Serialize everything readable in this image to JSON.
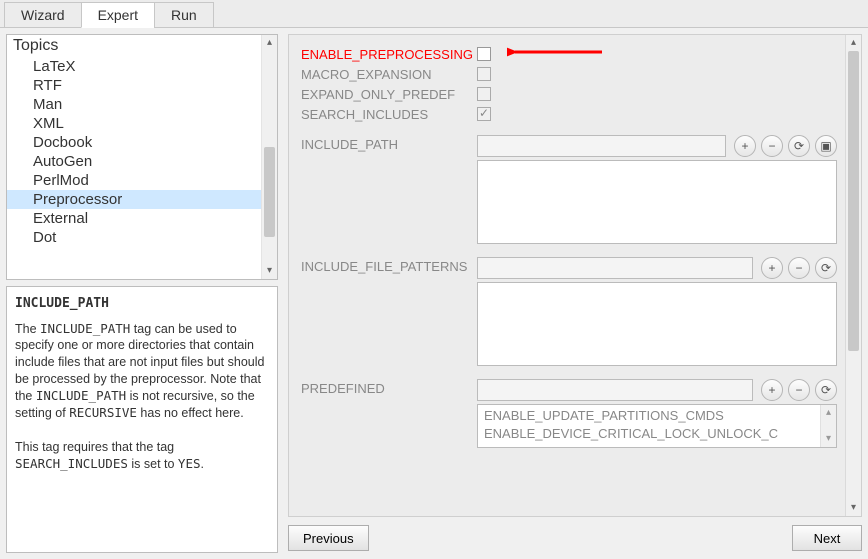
{
  "tabs": {
    "wizard": "Wizard",
    "expert": "Expert",
    "run": "Run",
    "active": "expert"
  },
  "tree": {
    "title": "Topics",
    "items": [
      {
        "label": "LaTeX"
      },
      {
        "label": "RTF"
      },
      {
        "label": "Man"
      },
      {
        "label": "XML"
      },
      {
        "label": "Docbook"
      },
      {
        "label": "AutoGen"
      },
      {
        "label": "PerlMod"
      },
      {
        "label": "Preprocessor",
        "selected": true
      },
      {
        "label": "External"
      },
      {
        "label": "Dot"
      }
    ]
  },
  "help": {
    "title": "INCLUDE_PATH",
    "para1_a": "The ",
    "para1_m1": "INCLUDE_PATH",
    "para1_b": " tag can be used to specify one or more directories that contain include files that are not input files but should be processed by the preprocessor. Note that the ",
    "para1_m2": "INCLUDE_PATH",
    "para1_c": " is not recursive, so the setting of ",
    "para1_m3": "RECURSIVE",
    "para1_d": " has no effect here.",
    "para2_a": "This tag requires that the tag ",
    "para2_m1": "SEARCH_INCLUDES",
    "para2_b": " is set to ",
    "para2_m2": "YES",
    "para2_c": "."
  },
  "form": {
    "enable_preprocessing": "ENABLE_PREPROCESSING",
    "macro_expansion": "MACRO_EXPANSION",
    "expand_only_predef": "EXPAND_ONLY_PREDEF",
    "search_includes": "SEARCH_INCLUDES",
    "include_path": "INCLUDE_PATH",
    "include_file_patterns": "INCLUDE_FILE_PATTERNS",
    "predefined": "PREDEFINED",
    "predefined_items": [
      "ENABLE_UPDATE_PARTITIONS_CMDS",
      "ENABLE_DEVICE_CRITICAL_LOCK_UNLOCK_C"
    ]
  },
  "icons": {
    "plus": "+",
    "minus": "−",
    "refresh": "⟳",
    "folder": "▣"
  },
  "nav": {
    "previous": "Previous",
    "next": "Next"
  }
}
